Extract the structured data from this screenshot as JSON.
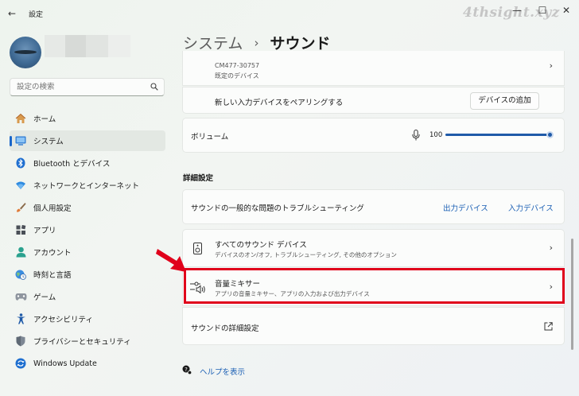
{
  "window": {
    "back_glyph": "←",
    "title": "設定",
    "controls": {
      "minimize": "—",
      "maximize": "☐",
      "close": "✕"
    },
    "watermark": "4thsight.xyz"
  },
  "search": {
    "placeholder": "設定の検索"
  },
  "nav": {
    "items": [
      {
        "label": "ホーム",
        "icon": "home-icon"
      },
      {
        "label": "システム",
        "icon": "system-icon",
        "active": true
      },
      {
        "label": "Bluetooth とデバイス",
        "icon": "bluetooth-icon"
      },
      {
        "label": "ネットワークとインターネット",
        "icon": "wifi-icon"
      },
      {
        "label": "個人用設定",
        "icon": "brush-icon"
      },
      {
        "label": "アプリ",
        "icon": "apps-icon"
      },
      {
        "label": "アカウント",
        "icon": "account-icon"
      },
      {
        "label": "時刻と言語",
        "icon": "globe-clock-icon"
      },
      {
        "label": "ゲーム",
        "icon": "gamepad-icon"
      },
      {
        "label": "アクセシビリティ",
        "icon": "accessibility-icon"
      },
      {
        "label": "プライバシーとセキュリティ",
        "icon": "shield-icon"
      },
      {
        "label": "Windows Update",
        "icon": "update-icon"
      }
    ]
  },
  "header": {
    "parent": "システム",
    "separator": "›",
    "current": "サウンド"
  },
  "input_device": {
    "model": "CM477-30757",
    "default_label": "既定のデバイス",
    "pair_label": "新しい入力デバイスをペアリングする",
    "add_device_button": "デバイスの追加"
  },
  "volume": {
    "label": "ボリューム",
    "value": "100",
    "level": 1.0
  },
  "advanced": {
    "section_title": "詳細設定",
    "troubleshoot_label": "サウンドの一般的な問題のトラブルシューティング",
    "output_device_link": "出力デバイス",
    "input_device_link": "入力デバイス",
    "all_devices_title": "すべてのサウンド デバイス",
    "all_devices_sub": "デバイスのオン/オフ, トラブルシューティング, その他のオプション",
    "mixer_title": "音量ミキサー",
    "mixer_sub": "アプリの音量ミキサー、アプリの入力および出力デバイス",
    "more_settings_label": "サウンドの詳細設定"
  },
  "help": {
    "label": "ヘルプを表示"
  },
  "glyphs": {
    "chevron": "›",
    "external": "↗"
  },
  "colors": {
    "accent": "#1f5aa8",
    "highlight": "#e0001b",
    "arrow": "#e0001b"
  }
}
